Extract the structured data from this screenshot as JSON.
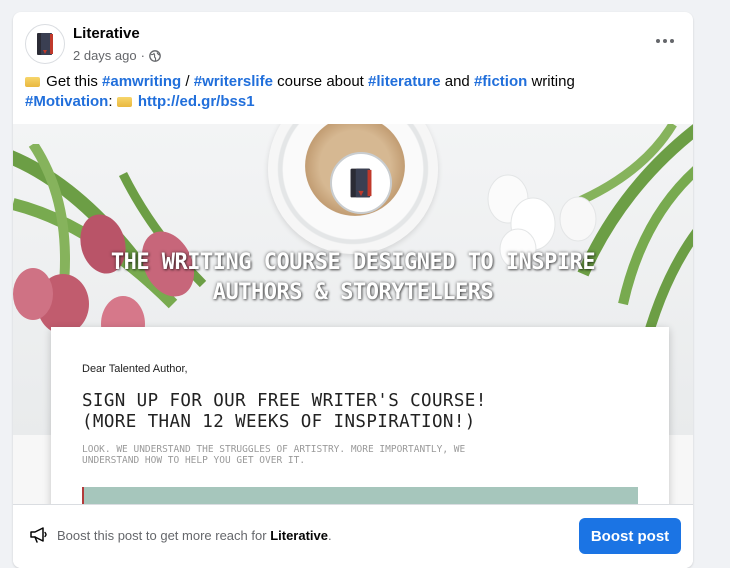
{
  "post": {
    "page_name": "Literative",
    "time": "2 days ago",
    "separator": "·",
    "privacy_icon": "globe-icon",
    "text": {
      "part1": "Get this",
      "hashtag_amwriting": "#amwriting",
      "slash": "/",
      "hashtag_writerslife": "#writerslife",
      "part2": "course about",
      "hashtag_literature": "#literature",
      "part3": "and",
      "hashtag_fiction": "#fiction",
      "part4": "writing",
      "hashtag_motivation": "#Motivation",
      "colon": ":",
      "link": "http://ed.gr/bss1"
    }
  },
  "image": {
    "headline_line1": "THE WRITING COURSE DESIGNED TO INSPIRE",
    "headline_line2": "AUTHORS & STORYTELLERS",
    "letter": {
      "salutation": "Dear Talented Author,",
      "signup_line1": "SIGN UP FOR OUR FREE WRITER'S COURSE!",
      "signup_line2": "(MORE THAN 12 WEEKS OF INSPIRATION!)",
      "intro_line1": "LOOK. WE UNDERSTAND THE STRUGGLES OF ARTISTRY. MORE IMPORTANTLY, WE",
      "intro_line2": "UNDERSTAND HOW TO HELP YOU GET OVER IT."
    }
  },
  "footer": {
    "boost_text_prefix": "Boost this post to get more reach for",
    "boost_text_page": "Literative",
    "boost_text_suffix": ".",
    "boost_button": "Boost post"
  },
  "colors": {
    "accent": "#1b74e4",
    "hashtag": "#216fdb",
    "muted": "#65676b"
  }
}
